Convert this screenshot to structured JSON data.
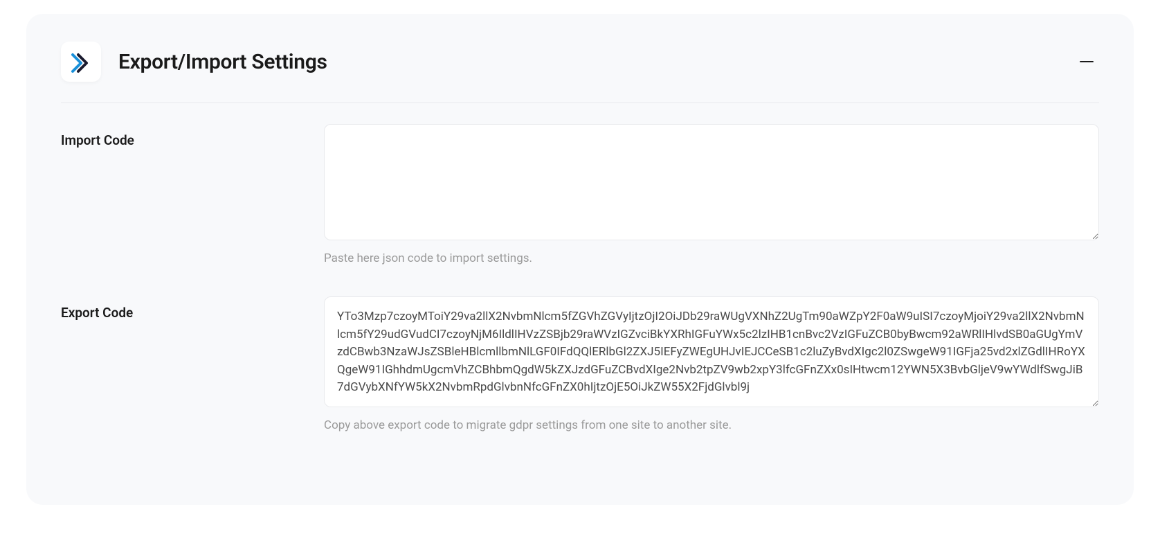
{
  "panel": {
    "title": "Export/Import Settings"
  },
  "import": {
    "label": "Import Code",
    "value": "",
    "help": "Paste here json code to import settings."
  },
  "export": {
    "label": "Export Code",
    "value": "YTo3Mzp7czoyMToiY29va2llX2NvbmNlcm5fZGVhZGVyIjtzOjI2OiJDb29raWUgVXNhZ2UgTm90aWZpY2F0aW9uISI7czoyMjoiY29va2llX2NvbmNlcm5fY29udGVudCI7czoyNjM6IldlIHVzZSBjb29raWVzIGZvciBkYXRhIGFuYWx5c2lzIHB1cnBvc2VzIGFuZCB0byBwcm92aWRlIHlvdSB0aGUgYmVzdCBwb3NzaWJsZSBleHBlcmllbmNlLGF0IFdQQlERlbGl2ZXJ5IEFyZWEgUHJvIEJCCeSB1c2luZyBvdXIgc2l0ZSwgeW91IGFja25vd2xlZGdlIHRoYXQgeW91IGhhdmUgcmVhZCBhbmQgdW5kZXJzdGFuZCBvdXIge2Nvb2tpZV9wb2xpY3lfcGFnZXx0sIHtwcm12YWN5X3BvbGljeV9wYWdlfSwgJiB7dGVybXNfYW5kX2NvbmRpdGlvbnNfcGFnZX0hIjtzOjE5OiJkZW55X2FjdGlvbl9j",
    "help": "Copy above export code to migrate gdpr settings from one site to another site."
  }
}
